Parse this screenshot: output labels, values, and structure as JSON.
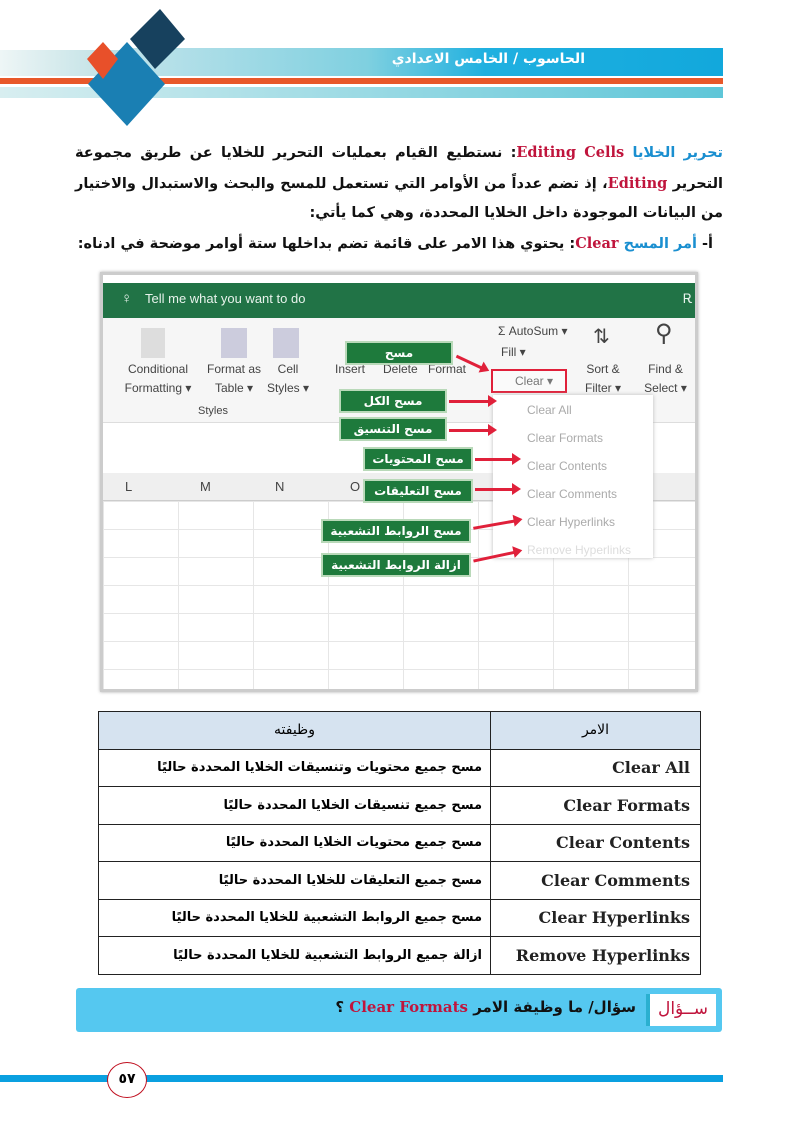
{
  "header": {
    "title": "الحاسوب / الخامس الاعدادي"
  },
  "intro": {
    "heading_ar": "تحرير الخلايا",
    "heading_en": "Editing Cells",
    "text1": ": نستطيع القيام بعمليات التحرير للخلايا عن طريق مجموعة التحرير ",
    "editing_en": "Editing",
    "text2": "، إذ تضم عدداً من الأوامر التي تستعمل للمسح والبحث والاستبدال والاختيار من البيانات الموجودة داخل الخلايا المحددة، وهي كما يأتي:",
    "item_prefix": "أ- ",
    "item_ar": "أمر المسح",
    "item_en": "Clear",
    "item_text": ": يحتوي هذا الامر على قائمة تضم بداخلها ستة أوامر موضحة في ادناه:"
  },
  "excel": {
    "tell_me": "Tell me what you want to do",
    "ribbon": {
      "conditional": "Conditional Formatting ▾",
      "format_table": "Format as Table ▾",
      "cell_styles": "Cell Styles ▾",
      "styles_group": "Styles",
      "insert": "Insert",
      "delete": "Delete",
      "format": "Format",
      "autosum": "Σ AutoSum ▾",
      "fill": "Fill ▾",
      "clear": "Clear ▾",
      "sort": "Sort & Filter ▾",
      "find": "Find & Select ▾"
    },
    "columns": [
      "L",
      "M",
      "N",
      "O"
    ],
    "menu": [
      "Clear All",
      "Clear Formats",
      "Clear Contents",
      "Clear Comments",
      "Clear Hyperlinks",
      "Remove Hyperlinks"
    ],
    "labels": [
      "مسح",
      "مسح الكل",
      "مسح التنسيق",
      "مسح المحتويات",
      "مسح التعليقات",
      "مسح الروابط التشعبية",
      "ازالة الروابط التشعبية"
    ],
    "accent": "#217346"
  },
  "table": {
    "headers": {
      "command": "الامر",
      "function": "وظيفته"
    },
    "rows": [
      {
        "command": "Clear All",
        "function": "مسح جميع محتويات وتنسيقات الخلايا المحددة حاليًا"
      },
      {
        "command": "Clear Formats",
        "function": "مسح جميع تنسيقات الخلايا المحددة حاليًا"
      },
      {
        "command": "Clear Contents",
        "function": "مسح جميع محتويات الخلايا المحددة حاليًا"
      },
      {
        "command": "Clear Comments",
        "function": "مسح جميع التعليقات للخلايا المحددة حاليًا"
      },
      {
        "command": "Clear Hyperlinks",
        "function": "مسح جميع الروابط التشعبية للخلايا المحددة حاليًا"
      },
      {
        "command": "Remove Hyperlinks",
        "function": "ازالة جميع الروابط التشعبية للخلايا المحددة حاليًا"
      }
    ]
  },
  "question": {
    "tag": "ســؤال",
    "text": "سؤال/ ما وظيفة الامر ",
    "command": "Clear Formats",
    "end": " ؟"
  },
  "footer": {
    "page_number": "٥٧"
  }
}
